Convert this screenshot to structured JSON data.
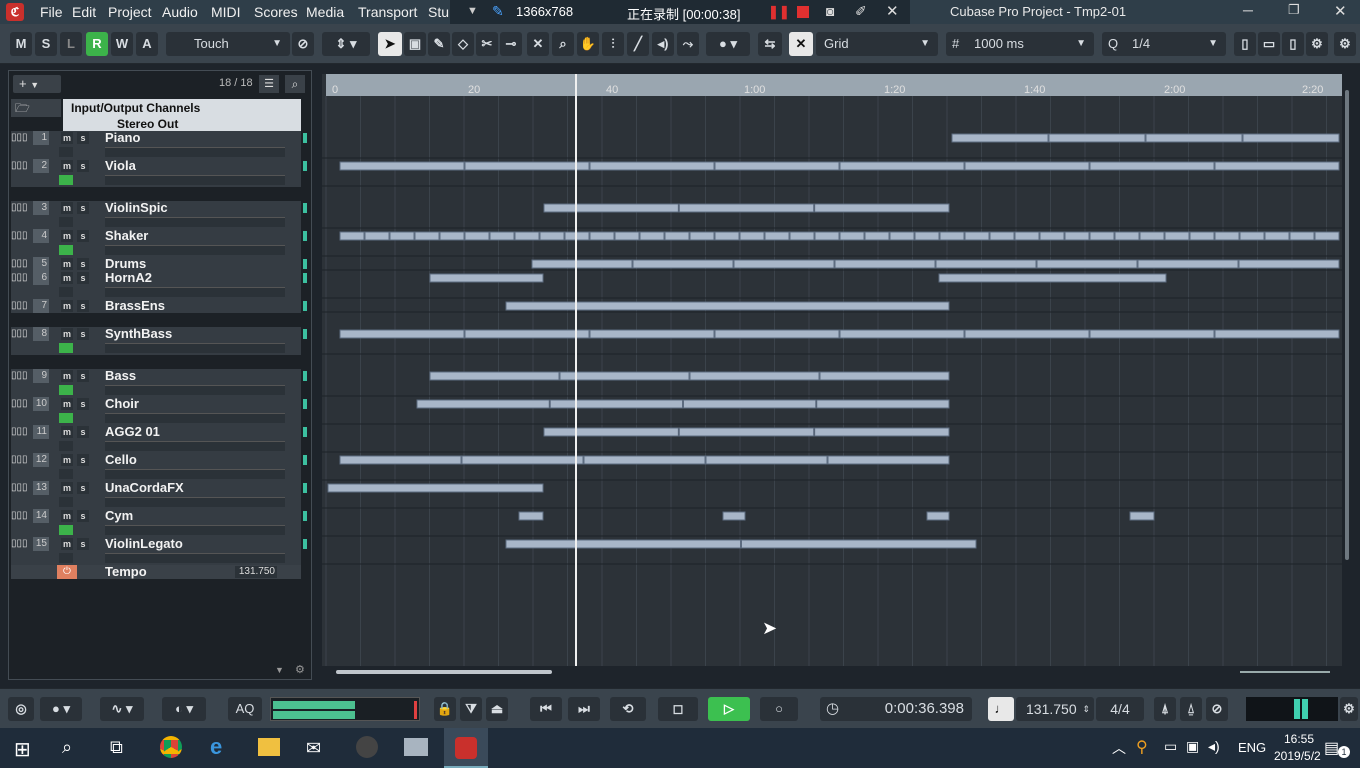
{
  "titlebar": {
    "menus": [
      "File",
      "Edit",
      "Project",
      "Audio",
      "MIDI",
      "Scores",
      "Media",
      "Transport",
      "Stu"
    ],
    "resolution": "1366x768",
    "recording": "正在录制 [00:00:38]",
    "project_title": "Cubase Pro Project - Tmp2-01"
  },
  "toolbar": {
    "m": "M",
    "s": "S",
    "l": "L",
    "r": "R",
    "w": "W",
    "a": "A",
    "automation_mode": "Touch",
    "snap_type": "Grid",
    "grid_value": "1000 ms",
    "quantize": "1/4"
  },
  "inspector": {
    "add": "+",
    "track_count": "18 / 18",
    "folder": "Input/Output Channels",
    "stereo_out": "Stereo Out"
  },
  "tracks": [
    {
      "num": "1",
      "name": "Piano"
    },
    {
      "num": "2",
      "name": "Viola"
    },
    {
      "num": "3",
      "name": "ViolinSpic"
    },
    {
      "num": "4",
      "name": "Shaker"
    },
    {
      "num": "5",
      "name": "Drums"
    },
    {
      "num": "6",
      "name": "HornA2"
    },
    {
      "num": "7",
      "name": "BrassEns"
    },
    {
      "num": "8",
      "name": "SynthBass"
    },
    {
      "num": "9",
      "name": "Bass"
    },
    {
      "num": "10",
      "name": "Choir"
    },
    {
      "num": "11",
      "name": "AGG2 01"
    },
    {
      "num": "12",
      "name": "Cello"
    },
    {
      "num": "13",
      "name": "UnaCordaFX"
    },
    {
      "num": "14",
      "name": "Cym"
    },
    {
      "num": "15",
      "name": "ViolinLegato"
    }
  ],
  "tempo_track": {
    "name": "Tempo",
    "value": "131.750"
  },
  "ruler": [
    "0",
    "20",
    "40",
    "1:00",
    "1:20",
    "1:40",
    "2:00",
    "2:20"
  ],
  "transport": {
    "aq": "AQ",
    "time": "0:00:36.398",
    "tempo": "131.750",
    "signature": "4/4"
  },
  "taskbar": {
    "lang": "ENG",
    "clock": "16:55",
    "date": "2019/5/2",
    "notif": "1"
  }
}
